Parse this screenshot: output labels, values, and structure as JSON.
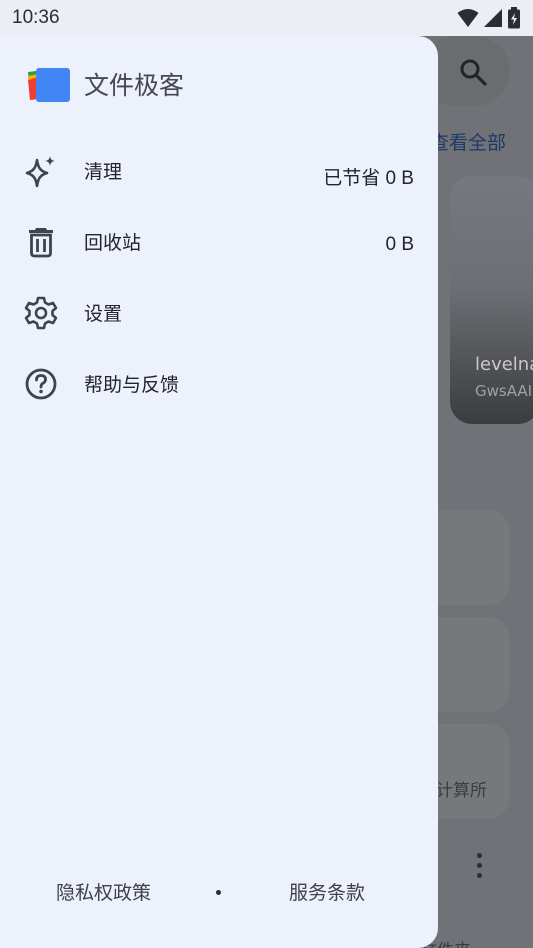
{
  "status_bar": {
    "time": "10:36"
  },
  "drawer": {
    "app_title": "文件极客",
    "items": [
      {
        "label": "清理",
        "value": "已节省 0 B",
        "icon": "sparkle-icon"
      },
      {
        "label": "回收站",
        "value": "0 B",
        "icon": "trash-icon"
      },
      {
        "label": "设置",
        "icon": "gear-icon"
      },
      {
        "label": "帮助与反馈",
        "icon": "help-icon"
      }
    ],
    "footer": {
      "privacy": "隐私权政策",
      "terms": "服务条款"
    }
  },
  "background": {
    "view_all": "查看全部",
    "card_title": "levelna",
    "card_subtitle": "GwsAAI",
    "tile_label": "计算所",
    "bottom_label": "文件夹"
  }
}
